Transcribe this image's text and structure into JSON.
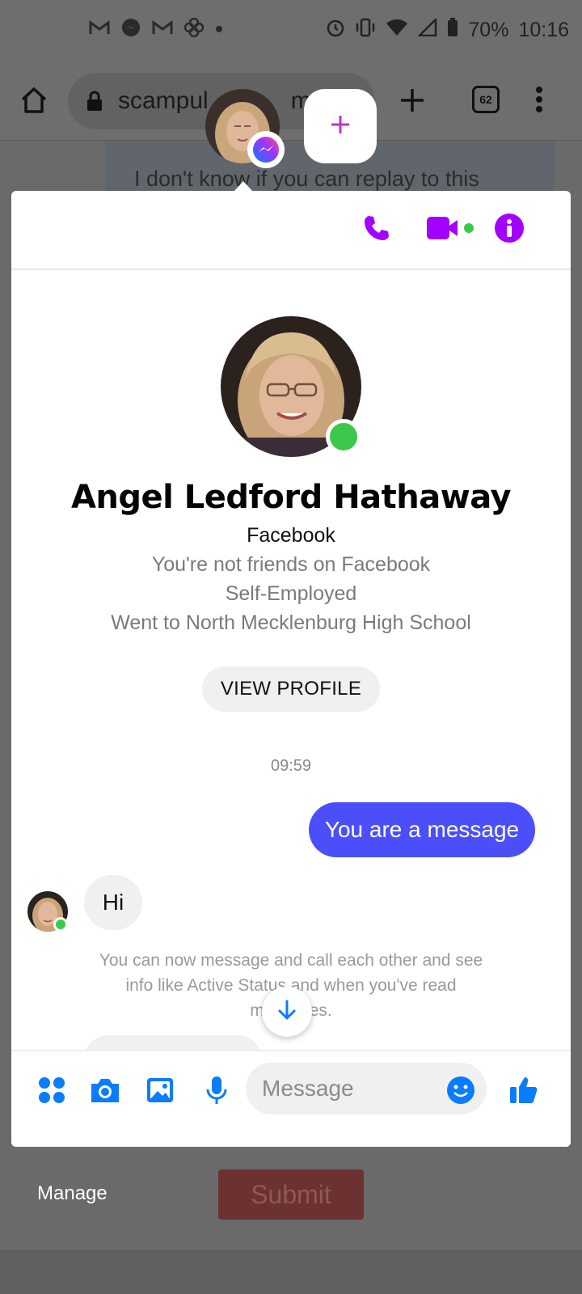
{
  "status_bar": {
    "battery": "70%",
    "time": "10:16",
    "left_icons": [
      "gmail-icon",
      "messenger-icon",
      "gmail-icon",
      "pinwheel-icon",
      "dot-icon"
    ],
    "right_icons": [
      "alarm-icon",
      "vibrate-icon",
      "wifi-icon",
      "signal-icon",
      "battery-icon"
    ]
  },
  "browser": {
    "url_fragment": "scampul",
    "url_suffix": "m/if",
    "tab_count": "62",
    "background_text": "I don't know if you can replay to this"
  },
  "chat": {
    "contact_name": "Angel Ledford Hathaway",
    "source": "Facebook",
    "friend_status": "You're not friends on Facebook",
    "work": "Self-Employed",
    "education": "Went to North Mecklenburg High School",
    "view_profile_label": "VIEW PROFILE",
    "timestamp": "09:59",
    "messages": [
      {
        "from": "me",
        "text": "You are a message"
      },
      {
        "from": "them",
        "text": "Hi"
      }
    ],
    "notice": "You can now message and call each other and see info like Active Status and when you've read messages.",
    "composer_placeholder": "Message"
  },
  "below_panel": {
    "manage_label": "Manage",
    "submit_label": "Submit"
  },
  "colors": {
    "accent_purple": "#a300ff",
    "accent_blue": "#0a7cff",
    "sent_bubble": "#4a4ffa",
    "online": "#3bc84a"
  }
}
